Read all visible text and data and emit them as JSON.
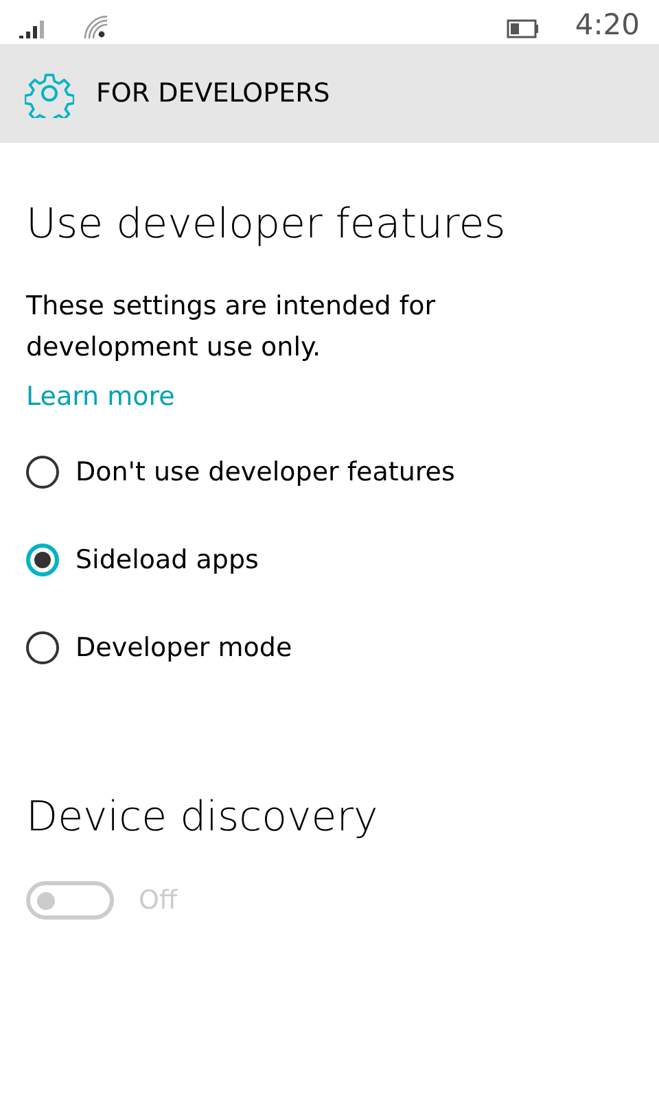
{
  "status_bar": {
    "time": "4:20"
  },
  "header": {
    "title": "FOR DEVELOPERS"
  },
  "developer_features": {
    "heading": "Use developer features",
    "description": "These settings are intended for development use only.",
    "link": "Learn more",
    "options": [
      {
        "label": "Don't use developer features",
        "selected": false
      },
      {
        "label": "Sideload apps",
        "selected": true
      },
      {
        "label": "Developer mode",
        "selected": false
      }
    ]
  },
  "device_discovery": {
    "heading": "Device discovery",
    "toggle": {
      "on": false,
      "disabled": true,
      "label": "Off"
    }
  }
}
